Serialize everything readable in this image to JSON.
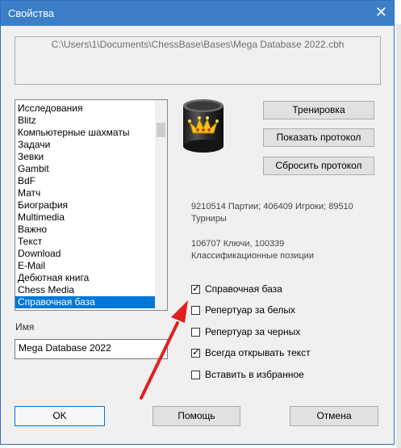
{
  "window": {
    "title": "Свойства",
    "close_glyph": "✕"
  },
  "path": "C:\\Users\\1\\Documents\\ChessBase\\Bases\\Mega Database 2022.cbh",
  "list": {
    "items": [
      "Исследования",
      "Blitz",
      "Компьютерные шахматы",
      "Задачи",
      "Зевки",
      "Gambit",
      "BdF",
      "Матч",
      "Биография",
      "Multimedia",
      "Важно",
      "Текст",
      "Download",
      "E-Mail",
      "Дебютная книга",
      "Chess Media",
      "Справочная база"
    ],
    "selected": "Справочная база"
  },
  "buttons": {
    "training": "Тренировка",
    "show_log": "Показать протокол",
    "reset_log": "Сбросить протокол",
    "ok": "OK",
    "help": "Помощь",
    "cancel": "Отмена"
  },
  "stats": {
    "line1": "9210514 Партии; 406409 Игроки; 89510",
    "line2": "Турниры",
    "line3": "106707 Ключи, 100339",
    "line4": "Классификационные позиции"
  },
  "checkboxes": [
    {
      "label": "Справочная база",
      "checked": true
    },
    {
      "label": "Репертуар за белых",
      "checked": false
    },
    {
      "label": "Репертуар за черных",
      "checked": false
    },
    {
      "label": "Всегда открывать текст",
      "checked": true
    },
    {
      "label": "Вставить в избранное",
      "checked": false
    }
  ],
  "name": {
    "label": "Имя",
    "value": "Mega Database 2022"
  },
  "colors": {
    "titlebar": "#3c7fc8",
    "selection": "#0078d7",
    "arrow": "#e0201e"
  },
  "icons": {
    "database": "database-crown-icon",
    "arrow": "red-arrow-icon"
  }
}
